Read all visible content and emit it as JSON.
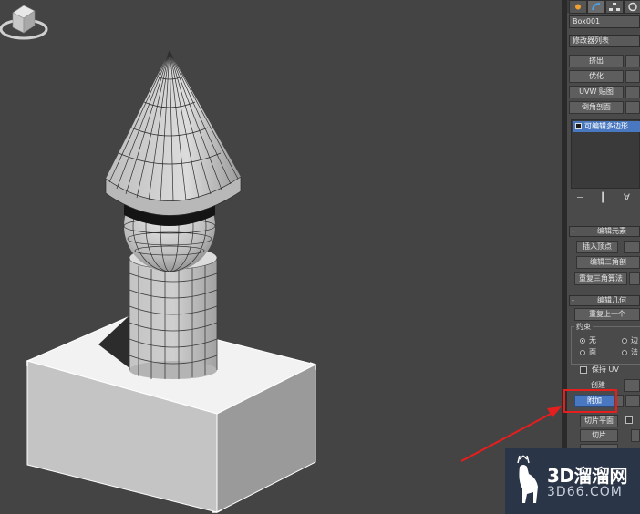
{
  "viewport": {
    "model": "3d-tower-model",
    "viewcube": "viewcube-icon"
  },
  "command_panel": {
    "tabs": [
      {
        "icon": "sun-icon"
      },
      {
        "icon": "modify-icon"
      },
      {
        "icon": "hierarchy-icon"
      },
      {
        "icon": "motion-icon"
      }
    ],
    "object_name": "Box001",
    "modifier_list": "修改器列表",
    "modifier_buttons": {
      "extrude": "挤出",
      "optimize": "优化",
      "uvw_map": "UVW 贴图",
      "bevel_profile": "倒角剖面"
    },
    "stack_item": "可编辑多边形",
    "stack_tools": [
      "pin-icon",
      "show-end-icon",
      "funnel-icon"
    ],
    "edit_elements": {
      "title": "编辑元素",
      "insert_vertex": "插入顶点",
      "edit_triangulation": "编辑三角剖",
      "retriangulate": "重复三角算法"
    },
    "edit_geometry": {
      "title": "编辑几何",
      "repeat_last": "重复上一个",
      "constraints_label": "约束",
      "constraint_none": "无",
      "constraint_edge": "边",
      "constraint_face": "面",
      "constraint_normal": "法",
      "preserve_uv": "保持 UV",
      "create": "创建",
      "attach": "附加",
      "slice_plane": "切片平面",
      "slice": "切片"
    }
  },
  "annotation": {
    "color": "#e51e1e"
  },
  "watermark": {
    "brand": "3D溜溜网",
    "url": "3D66.COM"
  }
}
